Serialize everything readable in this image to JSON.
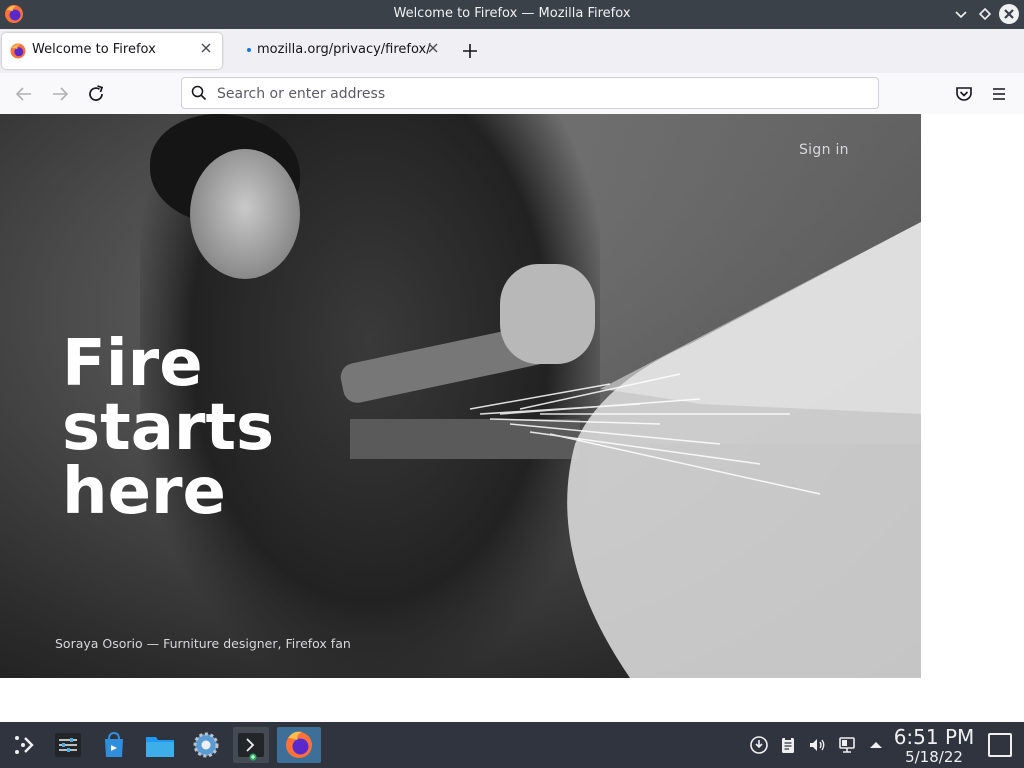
{
  "window": {
    "title": "Welcome to Firefox — Mozilla Firefox",
    "controls": [
      "minimize",
      "maximize",
      "close"
    ]
  },
  "tabs": [
    {
      "label": "Welcome to Firefox",
      "active": true,
      "icon": "firefox-icon"
    },
    {
      "label": "mozilla.org/privacy/firefox/",
      "active": false,
      "loading_dot": true
    }
  ],
  "toolbar": {
    "url_placeholder": "Search or enter address",
    "url_value": "",
    "buttons": [
      "back",
      "forward",
      "reload",
      "pocket",
      "app-menu"
    ]
  },
  "page": {
    "signin": "Sign in",
    "headline": [
      "Fire",
      "starts",
      "here"
    ],
    "caption": "Soraya Osorio — Furniture designer, Firefox fan"
  },
  "taskbar": {
    "apps": [
      "application-launcher",
      "settings-mixer",
      "discover",
      "dolphin",
      "system-settings",
      "konsole",
      "firefox"
    ],
    "time": "6:51 PM",
    "date": "5/18/22"
  },
  "colors": {
    "titlebar": "#3a4149",
    "tabstrip": "#f0f0f4",
    "taskbar": "#2f343f",
    "accent": "#3d6f99"
  }
}
